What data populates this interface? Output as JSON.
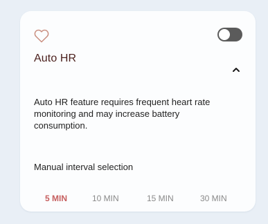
{
  "card": {
    "icon": "heart-outline-icon",
    "toggle": {
      "state": "off"
    },
    "title": "Auto HR",
    "expand_icon": "chevron-up-icon",
    "description": "Auto HR feature requires frequent heart rate monitoring and may increase battery consumption.",
    "interval_label": "Manual interval selection",
    "intervals": [
      {
        "label": "5 MIN",
        "selected": true
      },
      {
        "label": "10 MIN",
        "selected": false
      },
      {
        "label": "15 MIN",
        "selected": false
      },
      {
        "label": "30 MIN",
        "selected": false
      }
    ]
  },
  "colors": {
    "background": "#e9eff6",
    "card": "#fcfdfe",
    "accent": "#c65f5f",
    "title": "#4a1f1c",
    "toggle": "#5b5b5b"
  }
}
